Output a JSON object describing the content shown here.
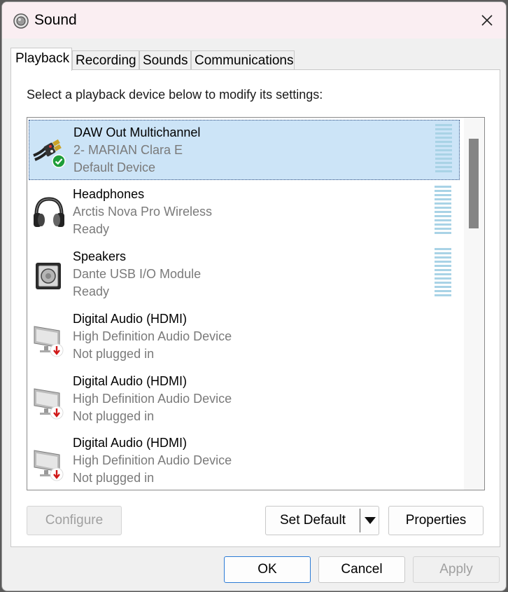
{
  "window": {
    "title": "Sound"
  },
  "tabs": [
    {
      "label": "Playback",
      "active": true
    },
    {
      "label": "Recording",
      "active": false
    },
    {
      "label": "Sounds",
      "active": false
    },
    {
      "label": "Communications",
      "active": false
    }
  ],
  "playback": {
    "instruction": "Select a playback device below to modify its settings:",
    "devices": [
      {
        "name": "DAW Out Multichannel",
        "description": "2- MARIAN Clara E",
        "status": "Default Device",
        "icon": "cable-plug-icon",
        "badge": "default-check-icon",
        "selected": true
      },
      {
        "name": "Headphones",
        "description": "Arctis Nova Pro Wireless",
        "status": "Ready",
        "icon": "headphones-icon"
      },
      {
        "name": "Speakers",
        "description": "Dante USB I/O Module",
        "status": "Ready",
        "icon": "speaker-icon"
      },
      {
        "name": "Digital Audio (HDMI)",
        "description": "High Definition Audio Device",
        "status": "Not plugged in",
        "icon": "monitor-icon",
        "badge": "unplugged-arrow-icon"
      },
      {
        "name": "Digital Audio (HDMI)",
        "description": "High Definition Audio Device",
        "status": "Not plugged in",
        "icon": "monitor-icon",
        "badge": "unplugged-arrow-icon"
      },
      {
        "name": "Digital Audio (HDMI)",
        "description": "High Definition Audio Device",
        "status": "Not plugged in",
        "icon": "monitor-icon",
        "badge": "unplugged-arrow-icon"
      }
    ]
  },
  "buttons": {
    "configure": "Configure",
    "set_default": "Set Default",
    "properties": "Properties",
    "ok": "OK",
    "cancel": "Cancel",
    "apply": "Apply"
  },
  "colors": {
    "selection": "#cce4f7",
    "accent": "#2b7bd6",
    "meter": "#a9d3e6",
    "check_badge": "#1e9e3a",
    "unplugged_badge": "#d01818"
  }
}
